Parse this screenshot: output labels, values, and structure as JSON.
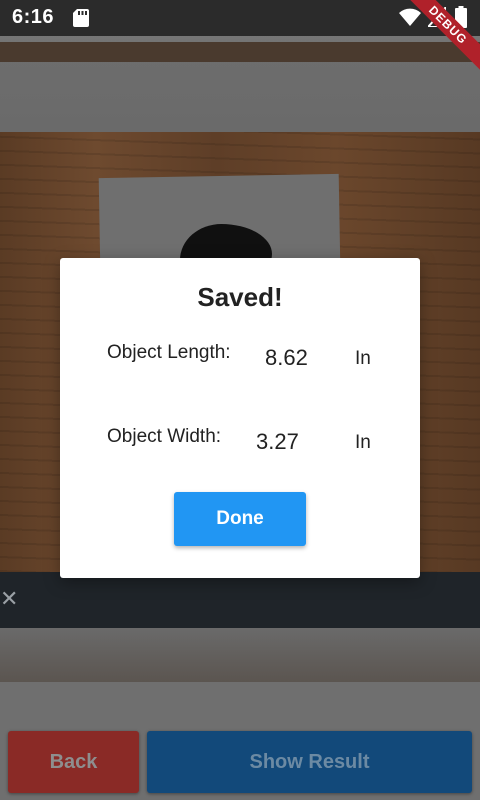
{
  "status_bar": {
    "time": "6:16",
    "icons": [
      "sd-card-icon",
      "wifi-icon",
      "signal-icon",
      "battery-icon"
    ]
  },
  "debug_banner": {
    "label": "DEBUG",
    "color": "#b0212a"
  },
  "dialog": {
    "title": "Saved!",
    "length_label": "Object Length:",
    "length_value": "8.62",
    "length_unit": "In",
    "width_label": "Object Width:",
    "width_value": "3.27",
    "width_unit": "In",
    "done_label": "Done",
    "done_color": "#2196f3"
  },
  "bottom_bar": {
    "back_label": "Back",
    "show_result_label": "Show Result",
    "back_color": "#e53935",
    "show_result_color": "#1976d2"
  }
}
